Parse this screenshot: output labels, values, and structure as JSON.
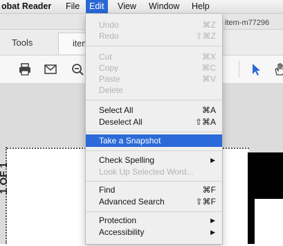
{
  "menubar": {
    "app_name": "obat Reader",
    "items": [
      "File",
      "Edit",
      "View",
      "Window",
      "Help"
    ],
    "active": "Edit"
  },
  "window": {
    "doc_title": "item-m77296"
  },
  "tabs": {
    "tools": "Tools",
    "document": "item"
  },
  "document": {
    "page_label": "1 OF 1"
  },
  "edit_menu": {
    "undo": {
      "label": "Undo",
      "shortcut": "⌘Z",
      "enabled": false
    },
    "redo": {
      "label": "Redo",
      "shortcut": "⇧⌘Z",
      "enabled": false
    },
    "cut": {
      "label": "Cut",
      "shortcut": "⌘X",
      "enabled": false
    },
    "copy": {
      "label": "Copy",
      "shortcut": "⌘C",
      "enabled": false
    },
    "paste": {
      "label": "Paste",
      "shortcut": "⌘V",
      "enabled": false
    },
    "delete": {
      "label": "Delete",
      "enabled": false
    },
    "select_all": {
      "label": "Select All",
      "shortcut": "⌘A",
      "enabled": true
    },
    "deselect_all": {
      "label": "Deselect All",
      "shortcut": "⇧⌘A",
      "enabled": true
    },
    "take_snapshot": {
      "label": "Take a Snapshot",
      "highlighted": true
    },
    "check_spelling": {
      "label": "Check Spelling",
      "submenu": "▶"
    },
    "look_up": {
      "label": "Look Up Selected Word...",
      "enabled": false
    },
    "find": {
      "label": "Find",
      "shortcut": "⌘F"
    },
    "advanced_search": {
      "label": "Advanced Search",
      "shortcut": "⇧⌘F"
    },
    "protection": {
      "label": "Protection",
      "submenu": "▶"
    },
    "accessibility": {
      "label": "Accessibility",
      "submenu": "▶"
    }
  },
  "colors": {
    "highlight": "#2b6ad8",
    "disabled_text": "#b3b3b3"
  }
}
